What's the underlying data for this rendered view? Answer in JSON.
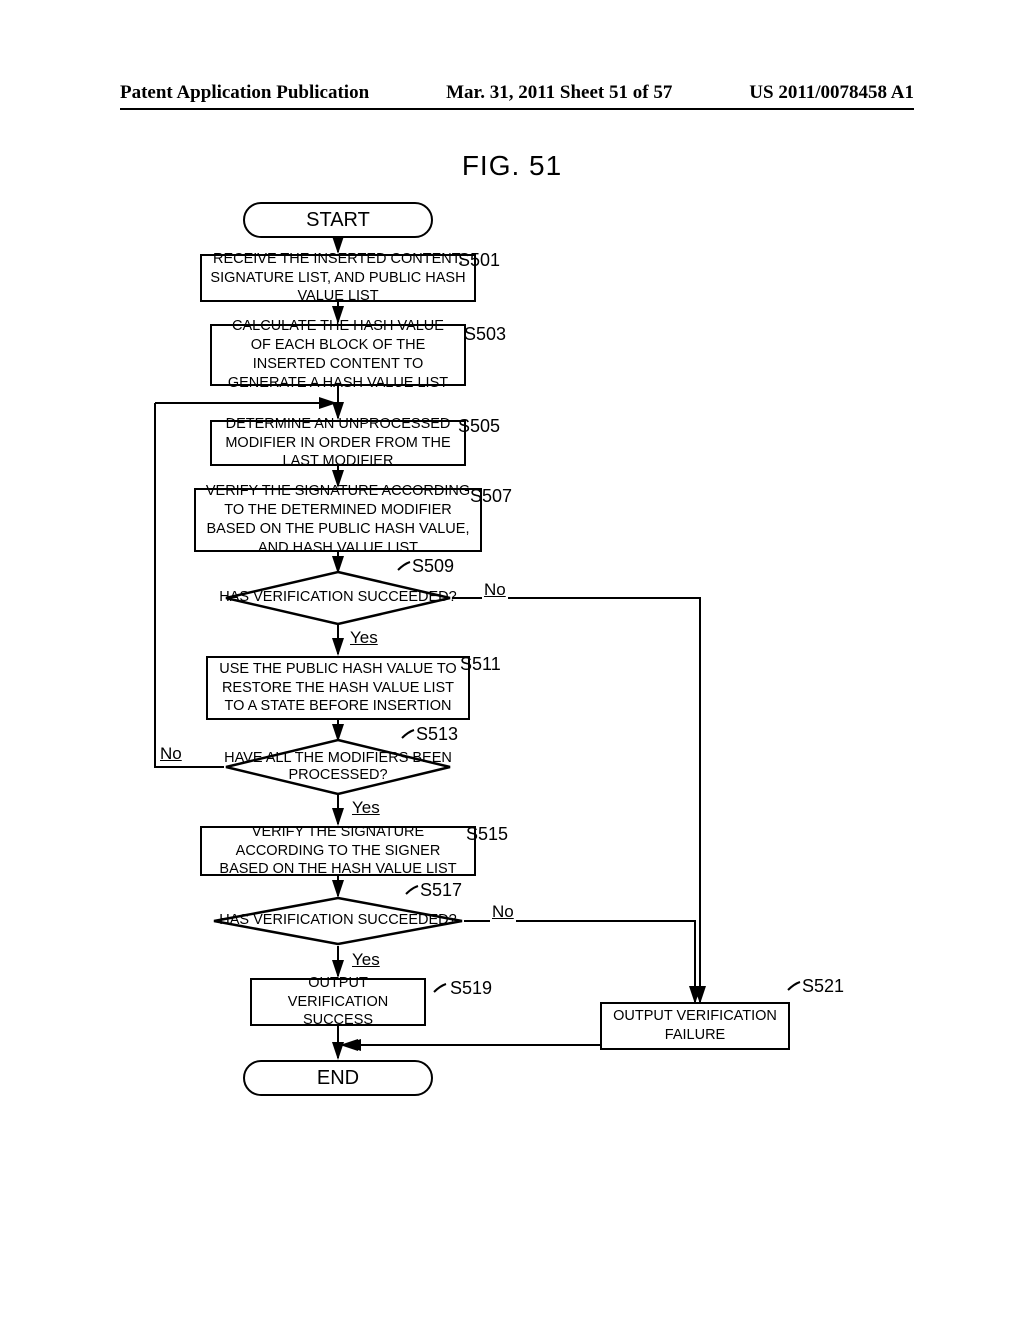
{
  "header": {
    "left": "Patent Application Publication",
    "center": "Mar. 31, 2011  Sheet 51 of 57",
    "right": "US 2011/0078458 A1"
  },
  "figure": {
    "title": "FIG. 51"
  },
  "flow": {
    "start": "START",
    "end": "END",
    "s501": {
      "label": "S501",
      "text": "RECEIVE THE INSERTED CONTENT, SIGNATURE LIST, AND PUBLIC HASH VALUE LIST"
    },
    "s503": {
      "label": "S503",
      "text": "CALCULATE THE HASH VALUE OF EACH BLOCK OF THE INSERTED CONTENT TO GENERATE A HASH VALUE LIST"
    },
    "s505": {
      "label": "S505",
      "text": "DETERMINE AN UNPROCESSED MODIFIER IN ORDER FROM THE LAST MODIFIER"
    },
    "s507": {
      "label": "S507",
      "text": "VERIFY THE SIGNATURE ACCORDING TO THE DETERMINED MODIFIER BASED ON THE PUBLIC HASH VALUE, AND HASH VALUE LIST"
    },
    "s509": {
      "label": "S509",
      "text": "HAS VERIFICATION SUCCEEDED?"
    },
    "s511": {
      "label": "S511",
      "text": "USE THE PUBLIC HASH VALUE TO RESTORE THE HASH VALUE LIST TO A STATE BEFORE INSERTION"
    },
    "s513": {
      "label": "S513",
      "text": "HAVE ALL THE MODIFIERS BEEN PROCESSED?"
    },
    "s515": {
      "label": "S515",
      "text": "VERIFY THE SIGNATURE ACCORDING TO THE SIGNER BASED ON THE HASH VALUE LIST"
    },
    "s517": {
      "label": "S517",
      "text": "HAS VERIFICATION SUCCEEDED?"
    },
    "s519": {
      "label": "S519",
      "text": "OUTPUT VERIFICATION SUCCESS"
    },
    "s521": {
      "label": "S521",
      "text": "OUTPUT VERIFICATION FAILURE"
    }
  },
  "labels": {
    "yes": "Yes",
    "no": "No"
  }
}
